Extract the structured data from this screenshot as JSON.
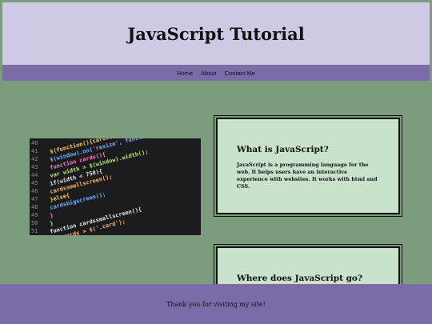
{
  "header": {
    "title": "JavaScript Tutorial"
  },
  "nav": {
    "items": [
      "Home",
      "About",
      "Contact Me"
    ]
  },
  "image": {
    "icon": "code-screenshot-image",
    "line_numbers": [
      "40",
      "41",
      "42",
      "43",
      "44",
      "45",
      "46",
      "47",
      "48",
      "49",
      "50",
      "51"
    ],
    "code_lines": [
      "$(function(){cards();});",
      "$(window).on('resize', function(){cards();});",
      "function cards(){",
      "  var width = $(window).width();",
      "  if(width < 750){",
      "    cardssmallscreen();",
      "  }else{",
      "    cardsbigscreen();",
      "  }",
      "}",
      "function cardssmallscreen(){",
      "  var cards = $('.card');"
    ]
  },
  "cards": [
    {
      "title": "What is JavaScript?",
      "body": "JavaScript is a programming language for the web. It helps users have an interactive experience with websites. It works with html and CSS."
    },
    {
      "title": "Where does JavaScript go?",
      "body": ""
    }
  ],
  "footer": {
    "text": "Thank you for visiting my site!"
  },
  "colors": {
    "page_bg": "#7b9c7f",
    "header_bg": "#d0c9e6",
    "nav_bg": "#7b6ba6",
    "card_bg": "#c8e2cc",
    "footer_bg": "#7b6ba6"
  }
}
